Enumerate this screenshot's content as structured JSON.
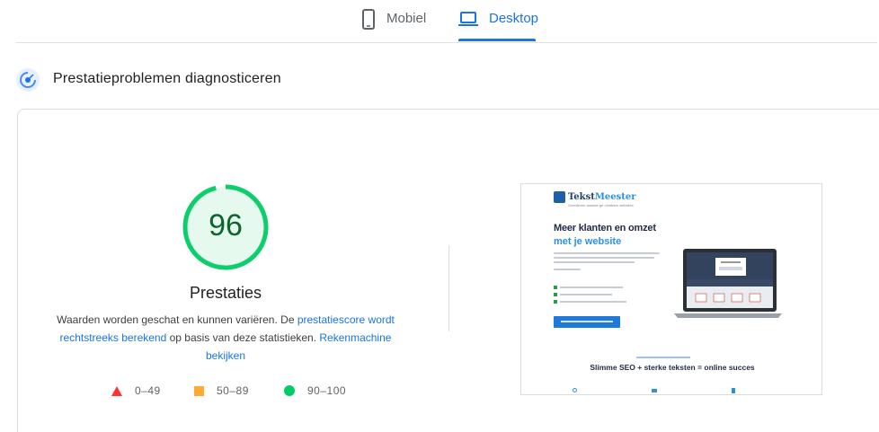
{
  "tabs": {
    "mobile_label": "Mobiel",
    "desktop_label": "Desktop",
    "active": "Desktop"
  },
  "section": {
    "title": "Prestatieproblemen diagnosticeren"
  },
  "gauge": {
    "score": "96",
    "title": "Prestaties",
    "status_color": "#0cce6b"
  },
  "description": {
    "text_1": "Waarden worden geschat en kunnen variëren. De ",
    "link_1": "prestatiescore wordt rechtstreeks berekend",
    "text_2": " op basis van deze statistieken. ",
    "link_2": "Rekenmachine bekijken"
  },
  "legend": {
    "fail": "0–49",
    "average": "50–89",
    "pass": "90–100"
  },
  "thumbnail": {
    "logo_part1": "Tekst",
    "logo_part2": "Meester",
    "tagline": "Goedlezen waarde-ge-vindbare websites",
    "headline_1": "Meer klanten en omzet",
    "headline_2": "met je website",
    "subheading": "Slimme SEO + sterke teksten = online succes"
  },
  "colors": {
    "accent": "#1a73e8",
    "fail": "#ff3333",
    "average": "#ffaa33",
    "pass": "#00cc66"
  }
}
